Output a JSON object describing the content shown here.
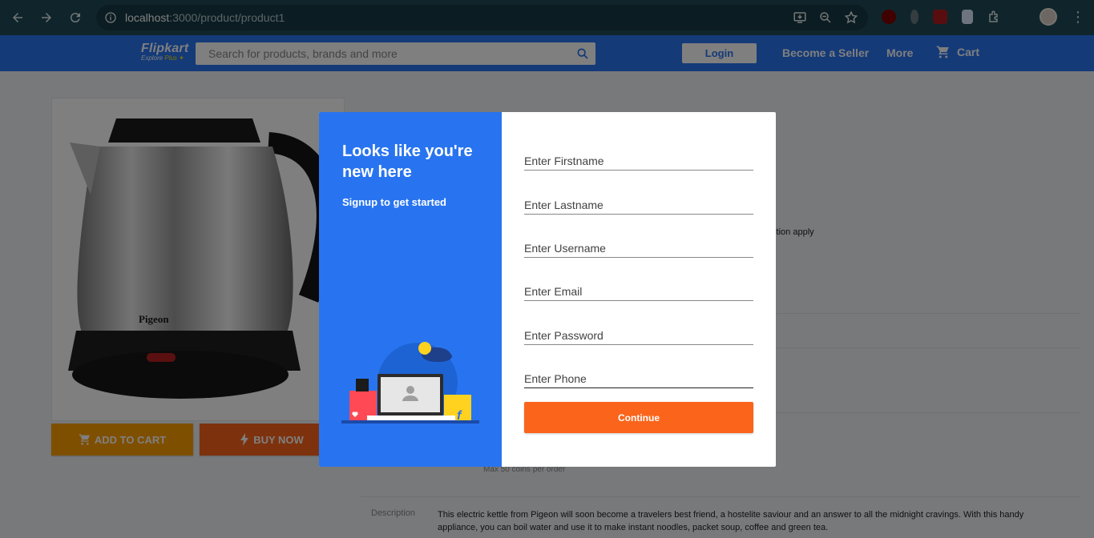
{
  "browser": {
    "url_host": "localhost",
    "url_rest": ":3000/product/product1"
  },
  "header": {
    "logo_main": "Flipkart",
    "logo_sub_a": "Explore ",
    "logo_sub_b": "Plus",
    "search_placeholder": "Search for products, brands and more",
    "login_label": "Login",
    "become_seller": "Become a Seller",
    "more": "More",
    "cart": "Cart"
  },
  "product": {
    "brand_on_image": "Pigeon",
    "add_to_cart": "ADD TO CART",
    "buy_now": "BUY NOW",
    "offer_tail": "dition apply",
    "coins_note": "Max 50 coins per order",
    "description_label": "Description",
    "description_text": "This electric kettle from Pigeon will soon become a travelers best friend, a hostelite saviour and an answer to all the midnight cravings. With this handy appliance, you can boil water and use it to make instant noodles, packet soup, coffee and green tea."
  },
  "modal": {
    "title": "Looks like you're new here",
    "subtitle": "Signup to get started",
    "fields": [
      {
        "placeholder": "Enter Firstname"
      },
      {
        "placeholder": "Enter Lastname"
      },
      {
        "placeholder": "Enter Username"
      },
      {
        "placeholder": "Enter Email"
      },
      {
        "placeholder": "Enter Password"
      },
      {
        "placeholder": "Enter Phone"
      }
    ],
    "continue_label": "Continue"
  },
  "colors": {
    "brand_blue": "#2874f0",
    "accent_orange": "#fb641b",
    "cart_yellow": "#ff9f00",
    "chrome_bg": "#1e4a56"
  }
}
